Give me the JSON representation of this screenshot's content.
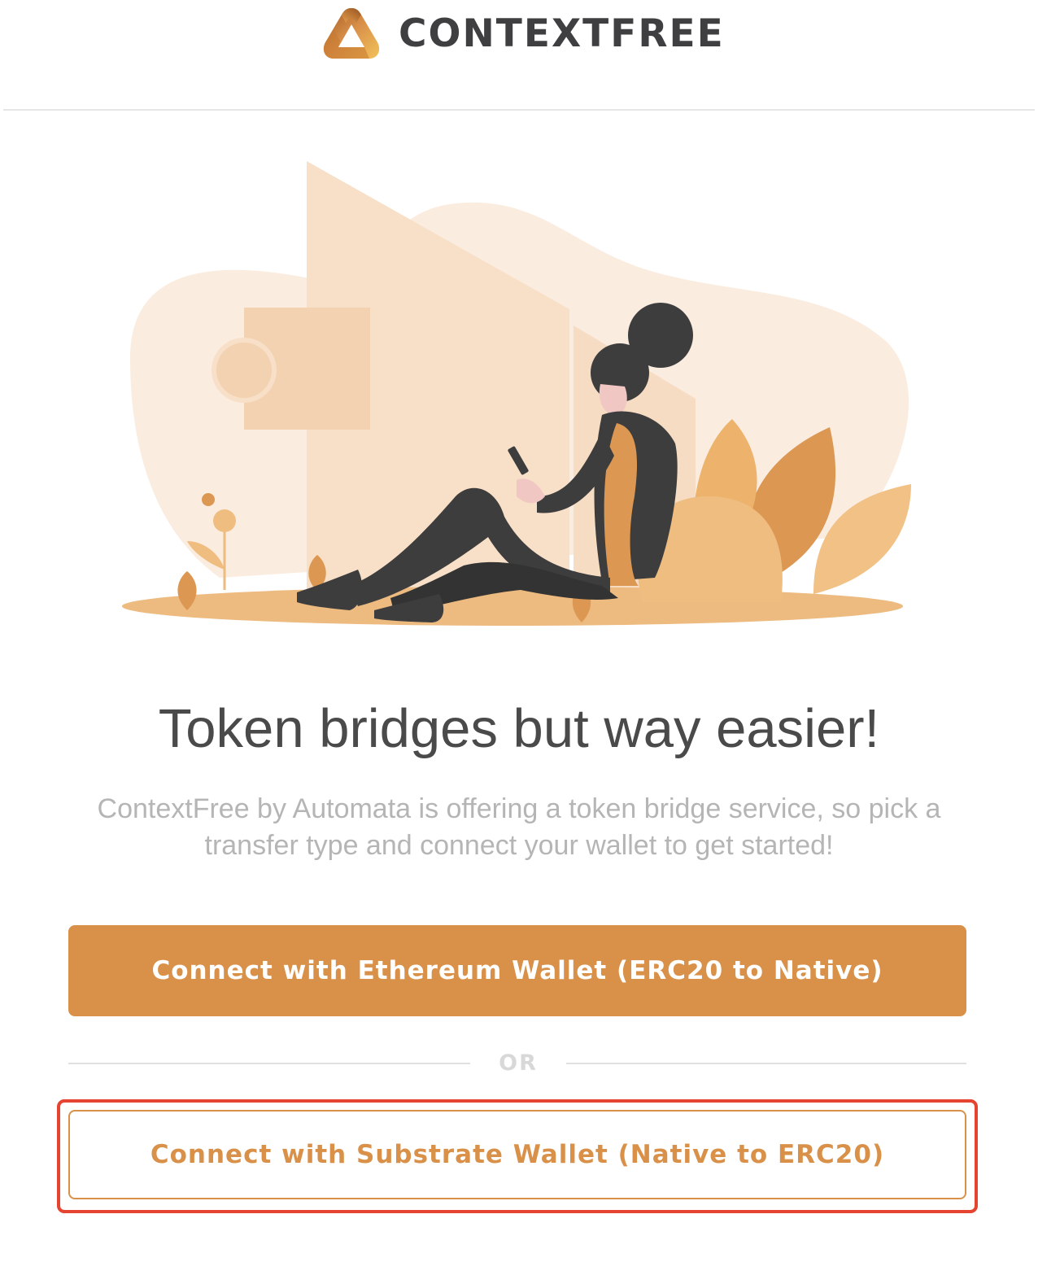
{
  "brand": {
    "name": "CONTEXTFREE",
    "logo_icon": "contextfree-triangle-logo-icon"
  },
  "hero": {
    "illustration": "woman-sitting-with-phone-illustration",
    "headline": "Token bridges but way easier!",
    "subtitle": "ContextFree by Automata is offering a token bridge service, so pick a transfer type and connect your wallet to get started!"
  },
  "actions": {
    "ethereum_button_label": "Connect with Ethereum Wallet (ERC20 to Native)",
    "separator_label": "OR",
    "substrate_button_label": "Connect with Substrate Wallet (Native to ERC20)"
  },
  "colors": {
    "accent": "#d9914a",
    "highlight_border": "#e54431",
    "headline": "#4a4a4a",
    "subtitle": "#b5b5b5"
  }
}
